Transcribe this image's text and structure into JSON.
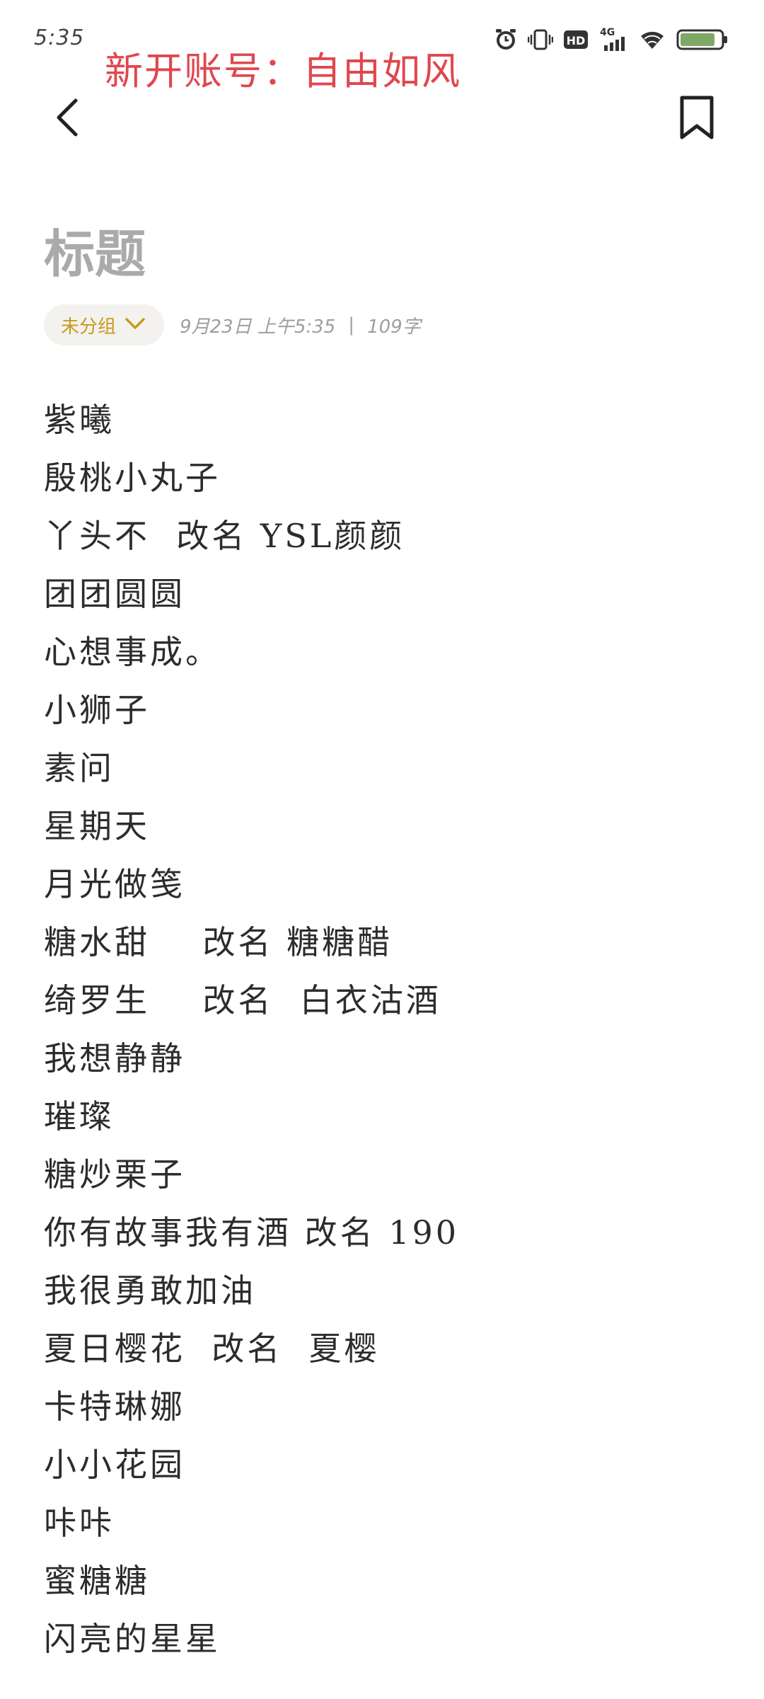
{
  "status_bar": {
    "time": "5:35",
    "network_label": "4G",
    "hd_label": "HD",
    "icons": [
      "alarm-icon",
      "vibrate-icon",
      "hd-icon",
      "signal-icon",
      "wifi-icon",
      "battery-icon"
    ],
    "battery_level": 0.85
  },
  "overlay_caption": "新开账号：自由如风",
  "note": {
    "title": "标题",
    "group_label": "未分组",
    "date": "9月23日 上午5:35",
    "separator": "|",
    "word_count": "109字",
    "lines": [
      "紫曦",
      "殷桃小丸子",
      "丫头不  改名 YSL颜颜",
      "团团圆圆",
      "心想事成。",
      "小狮子",
      "素问",
      "星期天",
      "月光做笺",
      "糖水甜    改名 糖糖醋",
      "绮罗生    改名  白衣沽酒",
      "我想静静",
      "璀璨",
      "糖炒栗子",
      "你有故事我有酒 改名 190",
      "我很勇敢加油",
      "夏日樱花  改名  夏樱",
      "卡特琳娜",
      "小小花园",
      "咔咔",
      "蜜糖糖",
      "闪亮的星星"
    ]
  },
  "colors": {
    "accent_gold": "#c99a1e",
    "overlay_red": "#e0474f",
    "title_gray": "#aaaaaa",
    "meta_gray": "#9e9e9e",
    "chip_bg": "#f3f2ef"
  }
}
